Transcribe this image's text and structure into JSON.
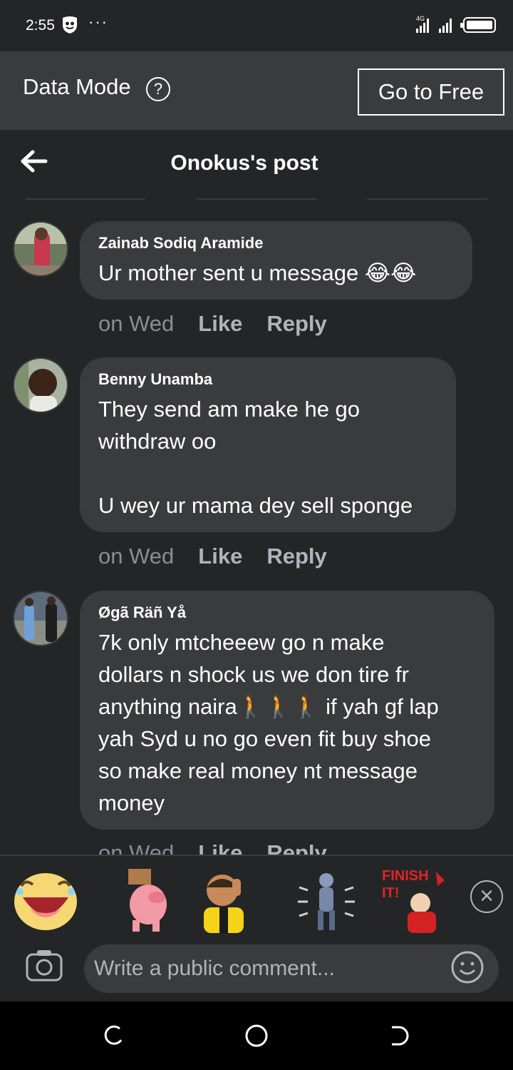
{
  "status_bar": {
    "time": "2:55",
    "dots": "···",
    "network": "4G"
  },
  "data_mode": {
    "label": "Data Mode",
    "help": "?",
    "button": "Go to Free"
  },
  "header": {
    "title": "Onokus's post"
  },
  "comments": [
    {
      "author": "Zainab Sodiq Aramide",
      "text": "Ur mother sent u message 😂😂",
      "time": "on Wed",
      "like": "Like",
      "reply": "Reply"
    },
    {
      "author": "Benny Unamba",
      "text": "They send am make he go\nwithdraw oo\n\nU wey ur mama dey sell sponge",
      "time": "on Wed",
      "like": "Like",
      "reply": "Reply"
    },
    {
      "author": "Øgã Räñ Yå",
      "text": "7k only mtcheeew go n make\ndollars n shock us we don tire fr\nanything naira🚶🚶🚶 if yah gf lap\nyah Syd u no go even fit buy shoe\nso make real money nt message\nmoney",
      "time": "on Wed",
      "like": "Like",
      "reply": "Reply"
    }
  ],
  "stickers": [
    "laughing-face-sticker",
    "pig-sticker",
    "referee-sticker",
    "running-man-sticker",
    "finish-it-sticker"
  ],
  "composer": {
    "placeholder": "Write a public comment..."
  },
  "colors": {
    "background": "#242526",
    "bubble": "#3a3b3c",
    "muted": "#8a8d91"
  }
}
